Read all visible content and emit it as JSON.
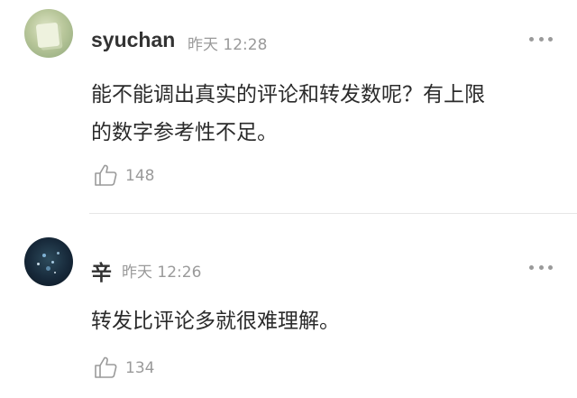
{
  "comments": [
    {
      "username": "syuchan",
      "time": "昨天 12:28",
      "text_lines": [
        "能不能调出真实的评论和转发数呢？有上限",
        "的数字参考性不足。"
      ],
      "likes": "148",
      "avatar_icon": "avatar-photo",
      "like_icon": "thumbs-up-icon",
      "more_icon": "more-dots-icon"
    },
    {
      "username": "辛",
      "time": "昨天 12:26",
      "text_lines": [
        "转发比评论多就很难理解。"
      ],
      "likes": "134",
      "avatar_icon": "avatar-photo",
      "like_icon": "thumbs-up-icon",
      "more_icon": "more-dots-icon"
    }
  ],
  "colors": {
    "username": "#333333",
    "meta": "#9a9a9a",
    "text": "#2b2b2b",
    "divider": "#e6e6e6"
  }
}
